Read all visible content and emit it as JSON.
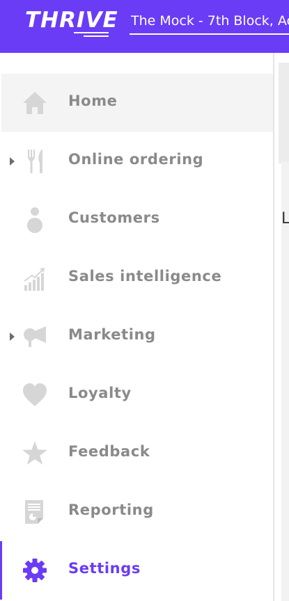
{
  "brand": {
    "logo_text": "THRIVE"
  },
  "header": {
    "store_name": "The Mock - 7th Block, Ac"
  },
  "nav": {
    "items": [
      {
        "label": "Home",
        "icon": "home-icon"
      },
      {
        "label": "Online ordering",
        "icon": "fork-knife-icon",
        "expandable": true
      },
      {
        "label": "Customers",
        "icon": "person-icon"
      },
      {
        "label": "Sales intelligence",
        "icon": "bar-chart-trend-icon"
      },
      {
        "label": "Marketing",
        "icon": "megaphone-icon",
        "expandable": true
      },
      {
        "label": "Loyalty",
        "icon": "heart-icon"
      },
      {
        "label": "Feedback",
        "icon": "star-icon"
      },
      {
        "label": "Reporting",
        "icon": "report-document-icon"
      },
      {
        "label": "Settings",
        "icon": "gear-icon",
        "selected": true
      }
    ]
  },
  "content": {
    "visible_letter": "L"
  },
  "colors": {
    "brand": "#6a3cf5",
    "icon_gray": "#d6d6d6",
    "label_gray": "#8a8a8a",
    "hover_bg": "#f4f4f4"
  }
}
